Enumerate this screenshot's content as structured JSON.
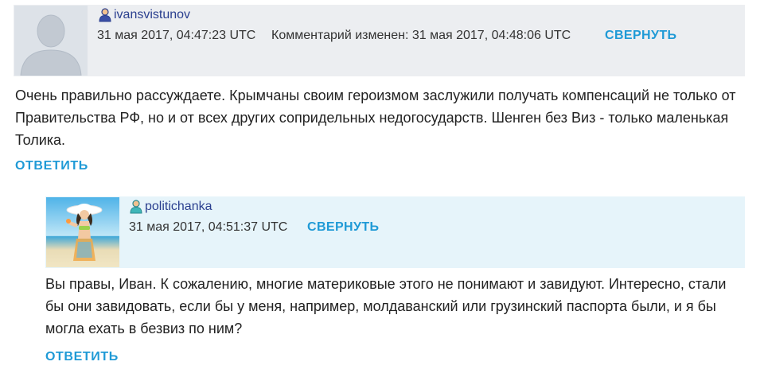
{
  "comments": [
    {
      "username": "ivansvistunov",
      "date": "31 мая 2017, 04:47:23 UTC",
      "edited": "Комментарий изменен:  31 мая 2017, 04:48:06 UTC",
      "collapse_label": "СВЕРНУТЬ",
      "body": "Очень правильно рассуждаете. Крымчаны своим героизмом заслужили получать компенсаций не только от Правительства РФ, но и от всех других сопридельных недогосударств. Шенген без Виз - только маленькая Толика.",
      "reply_label": "ОТВЕТИТЬ",
      "avatar": "default-user-avatar",
      "user_icon": "user-icon"
    },
    {
      "username": "politichanka",
      "date": "31 мая 2017, 04:51:37 UTC",
      "collapse_label": "СВЕРНУТЬ",
      "body": "Вы правы, Иван. К сожалению, многие материковые этого не понимают и завидуют. Интересно, стали бы они завидовать, если бы у меня, например, молдаванский или грузинский паспорта были, и я бы могла ехать в безвиз по ним?",
      "reply_label": "ОТВЕТИТЬ",
      "avatar": "beach-woman-avatar",
      "user_icon": "user-icon"
    }
  ],
  "colors": {
    "accent": "#1f9ad6",
    "username": "#2a3f8f",
    "header_bg_1": "#eceef1",
    "header_bg_2": "#e6f4fa"
  }
}
